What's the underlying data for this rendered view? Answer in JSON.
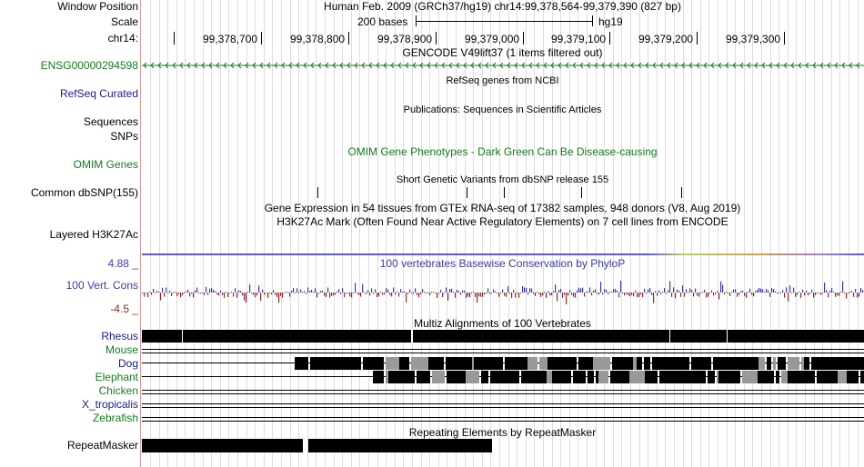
{
  "header": {
    "window_label": "Window Position",
    "window_value": "Human Feb. 2009 (GRCh37/hg19)   chr14:99,378,564-99,379,390 (827 bp)",
    "scale_label": "Scale",
    "scale_text": "200 bases",
    "scale_db": "hg19",
    "chr_label": "chr14:",
    "positions": [
      "99,378,700",
      "99,378,800",
      "99,378,900",
      "99,379,000",
      "99,379,100",
      "99,379,200",
      "99,379,300"
    ]
  },
  "tracks": {
    "gencode": {
      "title": "GENCODE V49lift37 (1 items filtered out)",
      "item": "ENSG00000294598",
      "color": "#157a1f"
    },
    "refseq": {
      "label": "RefSeq Curated",
      "title": "RefSeq genes from NCBI",
      "color": "#1a1a8c"
    },
    "pubs": {
      "label": "Sequences",
      "title": "Publications: Sequences in Scientific Articles"
    },
    "snps": {
      "label": "SNPs"
    },
    "omim": {
      "label": "OMIM Genes",
      "title": "OMIM Gene Phenotypes - Dark Green Can Be Disease-causing",
      "color": "#157a1f"
    },
    "dbsnp": {
      "label": "Common dbSNP(155)",
      "title": "Short Genetic Variants from dbSNP release 155"
    },
    "gtex": {
      "title": "Gene Expression in 54 tissues from GTEx RNA-seq of 17382 samples, 948 donors (V8, Aug 2019)"
    },
    "h3k27ac": {
      "label": "Layered H3K27Ac",
      "title": "H3K27Ac Mark (Often Found Near Active Regulatory Elements) on 7 cell lines from ENCODE"
    },
    "cons": {
      "label": "100 Vert. Cons",
      "title": "100 vertebrates Basewise Conservation by PhyloP",
      "max": "4.88 _",
      "min": "-4.5 _",
      "color": "#3b3ba6"
    },
    "multiz": {
      "title": "Multiz Alignments of 100 Vertebrates",
      "species": [
        "Rhesus",
        "Mouse",
        "Dog",
        "Elephant",
        "Chicken",
        "X_tropicalis",
        "Zebrafish"
      ],
      "colors": {
        "Rhesus": "#1a1a8c",
        "Mouse": "#157a1f",
        "Dog": "#1a1a8c",
        "Elephant": "#157a1f",
        "Chicken": "#157a1f",
        "X_tropicalis": "#1a1a8c",
        "Zebrafish": "#157a1f"
      }
    },
    "rmsk": {
      "label": "RepeatMasker",
      "title": "Repeating Elements by RepeatMasker"
    }
  }
}
